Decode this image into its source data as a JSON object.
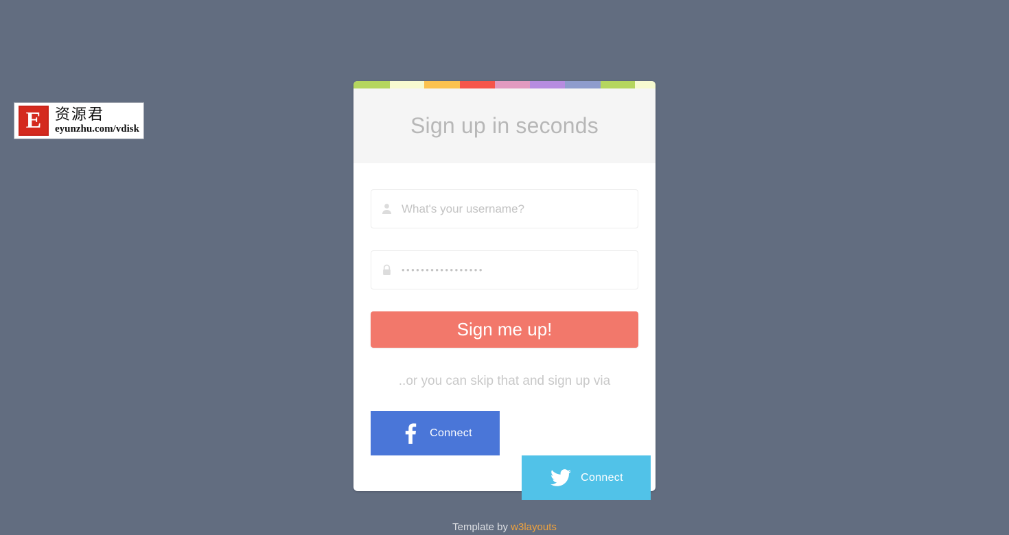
{
  "page": {
    "background_color": "#626d80"
  },
  "watermark": {
    "badge_letter": "E",
    "chinese_text": "资源君",
    "url_text": "eyunzhu.com/vdisk",
    "badge_color": "#d42a1e"
  },
  "card": {
    "title": "Sign up in seconds",
    "header_bg": "#f5f5f5",
    "stripes": [
      {
        "color": "#b5d65e",
        "width": 53
      },
      {
        "color": "#f7fad0",
        "width": 50
      },
      {
        "color": "#fcc24f",
        "width": 52
      },
      {
        "color": "#f6554a",
        "width": 51
      },
      {
        "color": "#e29ac0",
        "width": 51
      },
      {
        "color": "#b68ce0",
        "width": 51
      },
      {
        "color": "#8e9ccd",
        "width": 52
      },
      {
        "color": "#b5d65e",
        "width": 50
      },
      {
        "color": "#f7fad0",
        "width": 30
      }
    ]
  },
  "form": {
    "username": {
      "icon": "user-icon",
      "placeholder": "What's your username?",
      "value": ""
    },
    "password": {
      "icon": "lock-icon",
      "placeholder": "•••••••••••••••••",
      "value": ""
    },
    "submit_label": "Sign me up!",
    "submit_color": "#f2786b",
    "skip_text": "..or you can skip that and sign up via"
  },
  "social": {
    "facebook": {
      "icon": "facebook-icon",
      "label": "Connect",
      "color": "#4a76d8"
    },
    "twitter": {
      "icon": "twitter-icon",
      "label": "Connect",
      "color": "#51c2e8"
    }
  },
  "footer": {
    "prefix": "Template by ",
    "link_label": "w3layouts",
    "link_color": "#f0a23c"
  }
}
